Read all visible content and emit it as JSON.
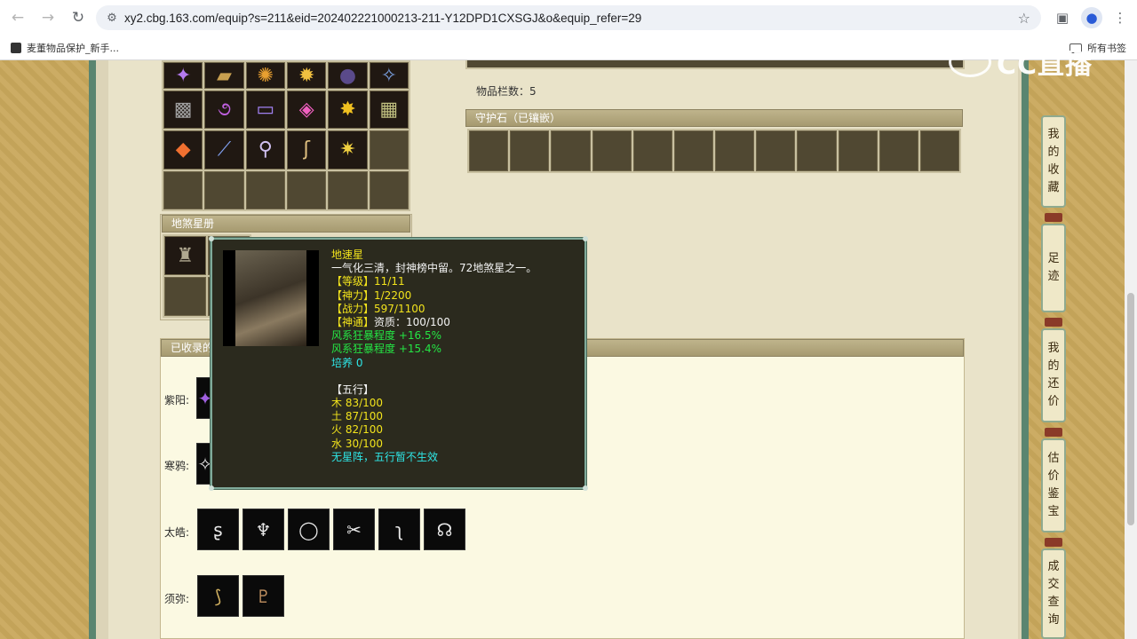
{
  "browser": {
    "url": "xy2.cbg.163.com/equip?s=211&eid=202402221000213-211-Y12DPD1CXSGJ&o&equip_refer=29",
    "bookmark": "麦董物品保护_新手...",
    "all_bookmarks": "所有书签"
  },
  "watermark": "CC直播",
  "inventory": {
    "slot_count_label": "物品栏数：5",
    "guard_stone_title": "守护石（已镶嵌）"
  },
  "star_book": {
    "title": "地煞星册"
  },
  "collected": {
    "title": "已收录的",
    "rows": [
      {
        "label": "紫阳:"
      },
      {
        "label": "寒鸦:"
      },
      {
        "label": "太皓:"
      },
      {
        "label": "须弥:"
      }
    ]
  },
  "tooltip": {
    "name": "地速星",
    "desc": "一气化三清，封神榜中留。72地煞星之一。",
    "level": "【等级】11/11",
    "power": "【神力】1/2200",
    "combat": "【战力】597/1100",
    "talent_label": "【神通】",
    "talent_value": "资质：100/100",
    "bonus1": "风系狂暴程度 +16.5%",
    "bonus2": "风系狂暴程度 +15.4%",
    "cultivate": "培养 0",
    "wuxing_title": "【五行】",
    "wood": "木 83/100",
    "earth": "土 87/100",
    "fire": "火 82/100",
    "water": "水 30/100",
    "formation": "无星阵，五行暂不生效"
  },
  "sidenav": [
    {
      "label": "我的收藏",
      "chars": [
        "我",
        "的",
        "收",
        "藏"
      ]
    },
    {
      "label": "足迹",
      "chars": [
        "足",
        "迹"
      ]
    },
    {
      "label": "我的还价",
      "chars": [
        "我",
        "的",
        "还",
        "价"
      ]
    },
    {
      "label": "估价鉴宝",
      "chars": [
        "估",
        "价",
        "鉴",
        "宝"
      ]
    },
    {
      "label": "成交查询",
      "chars": [
        "成",
        "交",
        "查",
        "询"
      ]
    }
  ],
  "icons": [
    "back-arrow-icon",
    "forward-arrow-icon",
    "reload-icon",
    "site-info-icon",
    "star-icon",
    "sidebar-icon",
    "profile-icon",
    "menu-icon",
    "folder-icon"
  ]
}
